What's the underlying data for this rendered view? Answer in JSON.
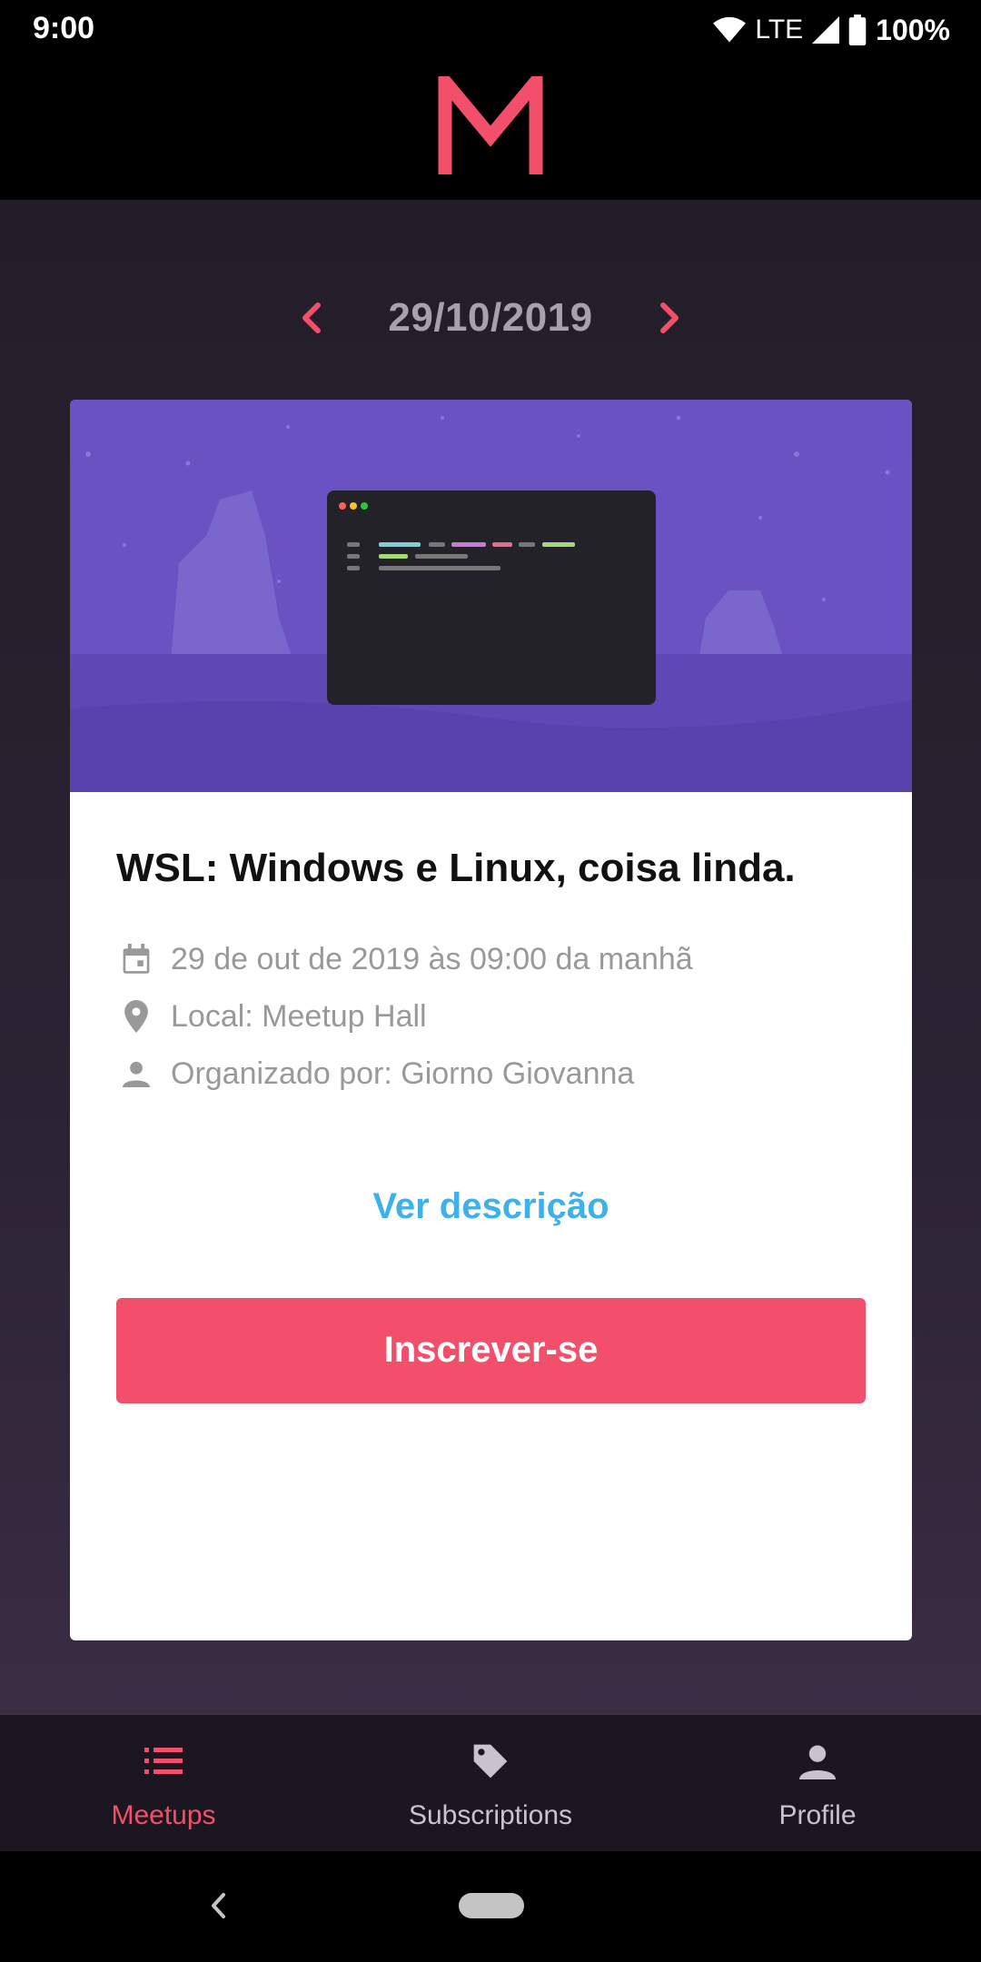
{
  "status_bar": {
    "time": "9:00",
    "network": "LTE",
    "battery": "100%"
  },
  "header": {
    "logo_icon": "m-logo-icon",
    "logo_color": "#f24f6b"
  },
  "date_nav": {
    "date": "29/10/2019",
    "prev_icon": "chevron-left-icon",
    "next_icon": "chevron-right-icon",
    "arrow_color": "#f24f6b"
  },
  "meetup_card": {
    "title": "WSL: Windows e Linux, coisa linda.",
    "date_text": "29 de out de 2019 às 09:00 da manhã",
    "location_text": "Local: Meetup Hall",
    "organizer_text": "Organizado por: Giorno Giovanna",
    "description_link": "Ver descrição",
    "subscribe_label": "Inscrever-se",
    "subscribe_color": "#f24f6b",
    "link_color": "#3fb0e8"
  },
  "tab_bar": {
    "tabs": [
      {
        "label": "Meetups",
        "icon": "list-icon",
        "active": true
      },
      {
        "label": "Subscriptions",
        "icon": "tag-icon",
        "active": false
      },
      {
        "label": "Profile",
        "icon": "person-icon",
        "active": false
      }
    ]
  },
  "nav_bar": {
    "back_icon": "back-icon",
    "home_icon": "home-pill-icon"
  }
}
